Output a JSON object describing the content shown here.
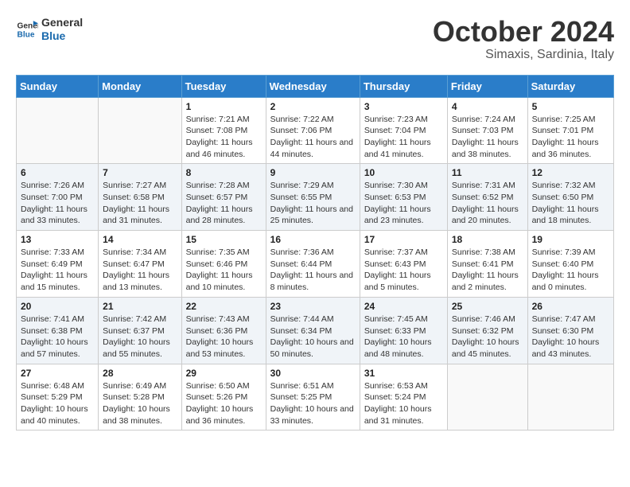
{
  "logo": {
    "line1": "General",
    "line2": "Blue"
  },
  "title": "October 2024",
  "subtitle": "Simaxis, Sardinia, Italy",
  "weekdays": [
    "Sunday",
    "Monday",
    "Tuesday",
    "Wednesday",
    "Thursday",
    "Friday",
    "Saturday"
  ],
  "weeks": [
    [
      {
        "day": "",
        "info": ""
      },
      {
        "day": "",
        "info": ""
      },
      {
        "day": "1",
        "sunrise": "7:21 AM",
        "sunset": "7:08 PM",
        "daylight": "11 hours and 46 minutes."
      },
      {
        "day": "2",
        "sunrise": "7:22 AM",
        "sunset": "7:06 PM",
        "daylight": "11 hours and 44 minutes."
      },
      {
        "day": "3",
        "sunrise": "7:23 AM",
        "sunset": "7:04 PM",
        "daylight": "11 hours and 41 minutes."
      },
      {
        "day": "4",
        "sunrise": "7:24 AM",
        "sunset": "7:03 PM",
        "daylight": "11 hours and 38 minutes."
      },
      {
        "day": "5",
        "sunrise": "7:25 AM",
        "sunset": "7:01 PM",
        "daylight": "11 hours and 36 minutes."
      }
    ],
    [
      {
        "day": "6",
        "sunrise": "7:26 AM",
        "sunset": "7:00 PM",
        "daylight": "11 hours and 33 minutes."
      },
      {
        "day": "7",
        "sunrise": "7:27 AM",
        "sunset": "6:58 PM",
        "daylight": "11 hours and 31 minutes."
      },
      {
        "day": "8",
        "sunrise": "7:28 AM",
        "sunset": "6:57 PM",
        "daylight": "11 hours and 28 minutes."
      },
      {
        "day": "9",
        "sunrise": "7:29 AM",
        "sunset": "6:55 PM",
        "daylight": "11 hours and 25 minutes."
      },
      {
        "day": "10",
        "sunrise": "7:30 AM",
        "sunset": "6:53 PM",
        "daylight": "11 hours and 23 minutes."
      },
      {
        "day": "11",
        "sunrise": "7:31 AM",
        "sunset": "6:52 PM",
        "daylight": "11 hours and 20 minutes."
      },
      {
        "day": "12",
        "sunrise": "7:32 AM",
        "sunset": "6:50 PM",
        "daylight": "11 hours and 18 minutes."
      }
    ],
    [
      {
        "day": "13",
        "sunrise": "7:33 AM",
        "sunset": "6:49 PM",
        "daylight": "11 hours and 15 minutes."
      },
      {
        "day": "14",
        "sunrise": "7:34 AM",
        "sunset": "6:47 PM",
        "daylight": "11 hours and 13 minutes."
      },
      {
        "day": "15",
        "sunrise": "7:35 AM",
        "sunset": "6:46 PM",
        "daylight": "11 hours and 10 minutes."
      },
      {
        "day": "16",
        "sunrise": "7:36 AM",
        "sunset": "6:44 PM",
        "daylight": "11 hours and 8 minutes."
      },
      {
        "day": "17",
        "sunrise": "7:37 AM",
        "sunset": "6:43 PM",
        "daylight": "11 hours and 5 minutes."
      },
      {
        "day": "18",
        "sunrise": "7:38 AM",
        "sunset": "6:41 PM",
        "daylight": "11 hours and 2 minutes."
      },
      {
        "day": "19",
        "sunrise": "7:39 AM",
        "sunset": "6:40 PM",
        "daylight": "11 hours and 0 minutes."
      }
    ],
    [
      {
        "day": "20",
        "sunrise": "7:41 AM",
        "sunset": "6:38 PM",
        "daylight": "10 hours and 57 minutes."
      },
      {
        "day": "21",
        "sunrise": "7:42 AM",
        "sunset": "6:37 PM",
        "daylight": "10 hours and 55 minutes."
      },
      {
        "day": "22",
        "sunrise": "7:43 AM",
        "sunset": "6:36 PM",
        "daylight": "10 hours and 53 minutes."
      },
      {
        "day": "23",
        "sunrise": "7:44 AM",
        "sunset": "6:34 PM",
        "daylight": "10 hours and 50 minutes."
      },
      {
        "day": "24",
        "sunrise": "7:45 AM",
        "sunset": "6:33 PM",
        "daylight": "10 hours and 48 minutes."
      },
      {
        "day": "25",
        "sunrise": "7:46 AM",
        "sunset": "6:32 PM",
        "daylight": "10 hours and 45 minutes."
      },
      {
        "day": "26",
        "sunrise": "7:47 AM",
        "sunset": "6:30 PM",
        "daylight": "10 hours and 43 minutes."
      }
    ],
    [
      {
        "day": "27",
        "sunrise": "6:48 AM",
        "sunset": "5:29 PM",
        "daylight": "10 hours and 40 minutes."
      },
      {
        "day": "28",
        "sunrise": "6:49 AM",
        "sunset": "5:28 PM",
        "daylight": "10 hours and 38 minutes."
      },
      {
        "day": "29",
        "sunrise": "6:50 AM",
        "sunset": "5:26 PM",
        "daylight": "10 hours and 36 minutes."
      },
      {
        "day": "30",
        "sunrise": "6:51 AM",
        "sunset": "5:25 PM",
        "daylight": "10 hours and 33 minutes."
      },
      {
        "day": "31",
        "sunrise": "6:53 AM",
        "sunset": "5:24 PM",
        "daylight": "10 hours and 31 minutes."
      },
      {
        "day": "",
        "info": ""
      },
      {
        "day": "",
        "info": ""
      }
    ]
  ]
}
